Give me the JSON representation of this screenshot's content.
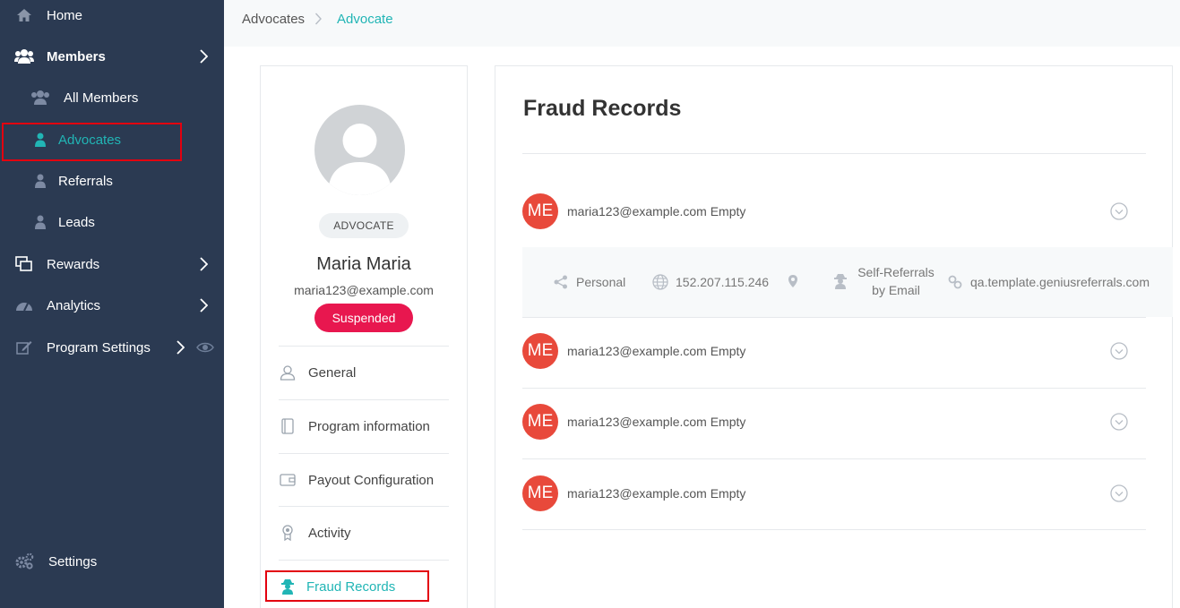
{
  "sidebar": {
    "items": [
      {
        "label": "Home",
        "icon": "home-icon"
      },
      {
        "label": "Members",
        "icon": "members-icon"
      },
      {
        "label": "All Members",
        "icon": "all-members-icon"
      },
      {
        "label": "Advocates",
        "icon": "advocate-icon"
      },
      {
        "label": "Referrals",
        "icon": "referral-icon"
      },
      {
        "label": "Leads",
        "icon": "lead-icon"
      },
      {
        "label": "Rewards",
        "icon": "rewards-icon"
      },
      {
        "label": "Analytics",
        "icon": "analytics-icon"
      },
      {
        "label": "Program Settings",
        "icon": "edit-icon"
      },
      {
        "label": "Settings",
        "icon": "gears-icon"
      }
    ]
  },
  "breadcrumb": {
    "root": "Advocates",
    "current": "Advocate"
  },
  "profile": {
    "role": "ADVOCATE",
    "name": "Maria Maria",
    "email": "maria123@example.com",
    "status": "Suspended",
    "menu": [
      {
        "label": "General"
      },
      {
        "label": "Program information"
      },
      {
        "label": "Payout Configuration"
      },
      {
        "label": "Activity"
      },
      {
        "label": "Fraud Records"
      }
    ]
  },
  "fraud": {
    "title": "Fraud Records",
    "records": [
      {
        "initials": "ME",
        "text": "maria123@example.com Empty"
      },
      {
        "initials": "ME",
        "text": "maria123@example.com Empty"
      },
      {
        "initials": "ME",
        "text": "maria123@example.com Empty"
      },
      {
        "initials": "ME",
        "text": "maria123@example.com Empty"
      }
    ],
    "details": {
      "source": "Personal",
      "ip": "152.207.115.246",
      "fraud_type_line1": "Self-Referrals",
      "fraud_type_line2": "by Email",
      "domain": "qa.template.geniusreferrals.com"
    }
  },
  "colors": {
    "sidebar_bg": "#2b3a52",
    "accent_teal": "#21b5b5",
    "status_red": "#e8174f",
    "avatar_red": "#e8493b",
    "highlight_red": "#e3000f"
  }
}
